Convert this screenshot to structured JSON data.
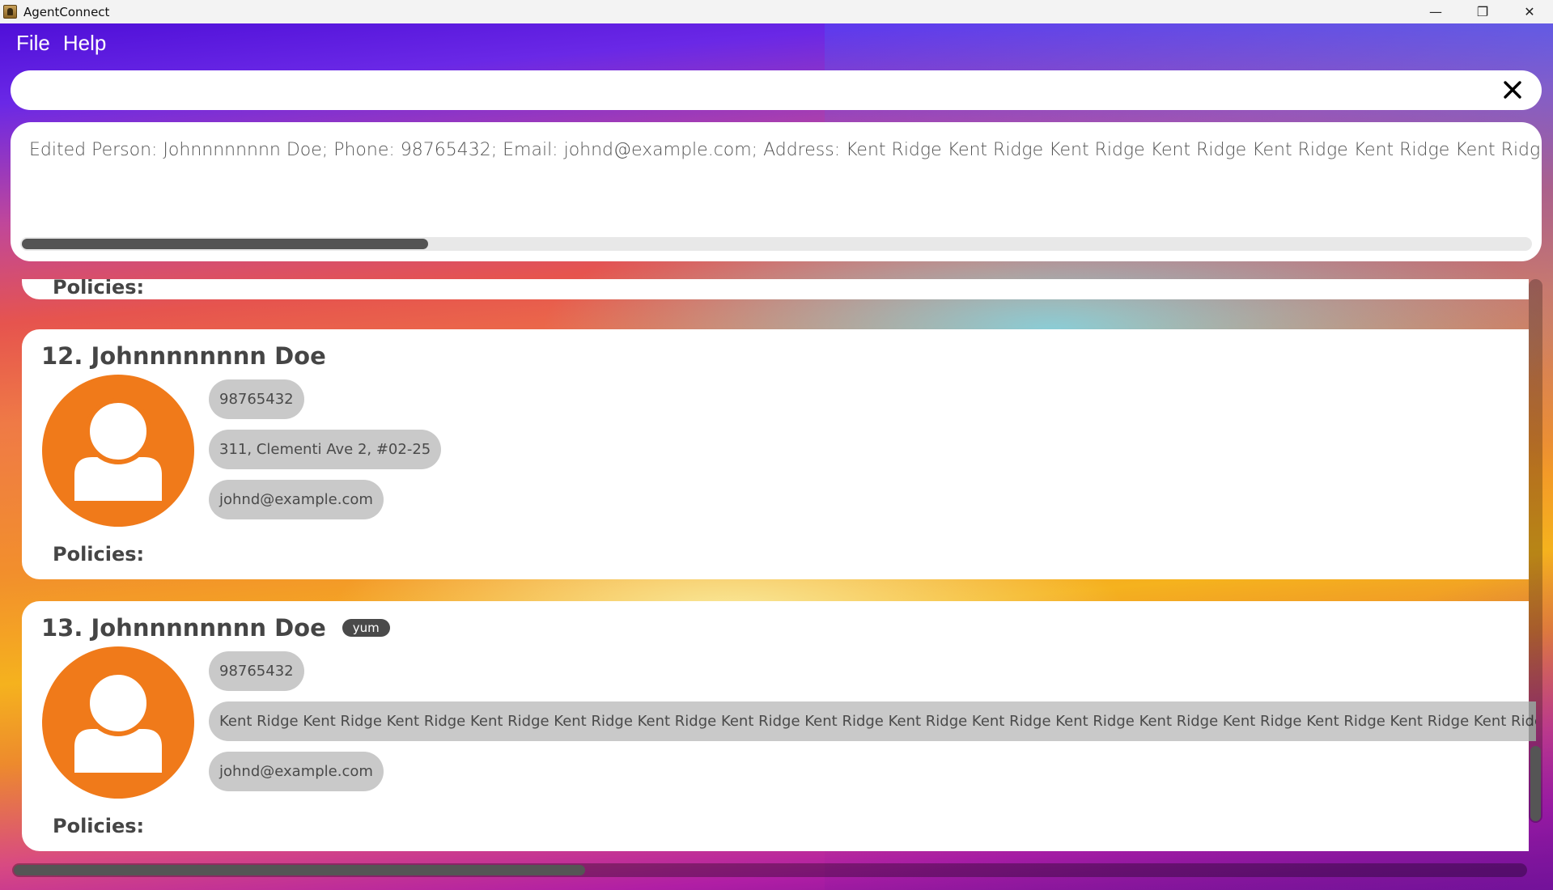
{
  "window": {
    "title": "AgentConnect",
    "minimize": "—",
    "restore": "❐",
    "close": "✕"
  },
  "menu": {
    "file": "File",
    "help": "Help"
  },
  "command": {
    "value": "",
    "placeholder": ""
  },
  "result": {
    "text": "Edited Person: Johnnnnnnnn Doe; Phone: 98765432; Email: johnd@example.com; Address: Kent Ridge Kent Ridge Kent Ridge Kent Ridge Kent Ridge Kent Ridge Kent Ridge Kent Ridge Kent R"
  },
  "persons": {
    "partial": {
      "policies_label": "Policies:"
    },
    "p12": {
      "name": "12. Johnnnnnnnn Doe",
      "phone": "98765432",
      "address": "311, Clementi Ave 2, #02-25",
      "email": "johnd@example.com",
      "policies_label": "Policies:"
    },
    "p13": {
      "name": "13. Johnnnnnnnn Doe",
      "tag": "yum",
      "phone": "98765432",
      "address": "Kent Ridge Kent Ridge Kent Ridge Kent Ridge Kent Ridge Kent Ridge Kent Ridge Kent Ridge Kent Ridge Kent Ridge Kent Ridge Kent Ridge Kent Ridge Kent Ridge Kent Ridge Kent Ridge Kent Ridge Kent Ridge K",
      "email": "johnd@example.com",
      "policies_label": "Policies:"
    }
  },
  "colors": {
    "avatar": "#f07a1a",
    "pill": "#c9c9c9",
    "tag": "#4a4a4a"
  },
  "icons": {
    "avatar": "person-icon",
    "clear": "close-icon"
  }
}
